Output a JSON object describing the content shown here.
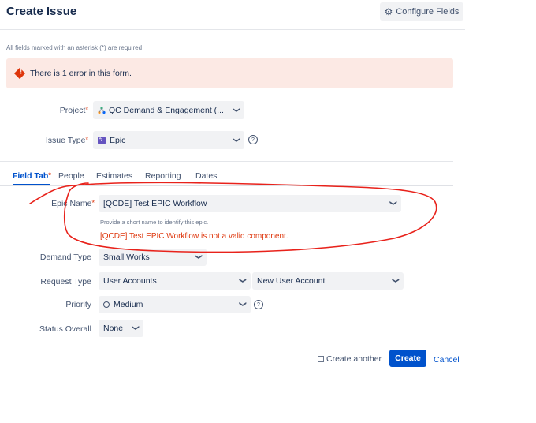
{
  "header": {
    "title": "Create Issue",
    "configure_label": "Configure Fields"
  },
  "required_note": "All fields marked with an asterisk (*) are required",
  "error_banner": {
    "text": "There is 1 error in this form."
  },
  "project": {
    "label": "Project",
    "value": "QC Demand & Engagement (..."
  },
  "issue_type": {
    "label": "Issue Type",
    "value": "Epic"
  },
  "tabs": [
    {
      "label": "Field Tab",
      "required": true
    },
    {
      "label": "People"
    },
    {
      "label": "Estimates"
    },
    {
      "label": "Reporting"
    },
    {
      "label": "Dates"
    }
  ],
  "epic_name": {
    "label": "Epic Name",
    "value": "[QCDE] Test EPIC Workflow",
    "hint": "Provide a short name to identify this epic.",
    "error": "[QCDE] Test EPIC Workflow is not a valid component."
  },
  "demand_type": {
    "label": "Demand Type",
    "value": "Small Works"
  },
  "request_type": {
    "label": "Request Type",
    "value": "User Accounts",
    "value2": "New User Account"
  },
  "priority": {
    "label": "Priority",
    "value": "Medium"
  },
  "status_overall": {
    "label": "Status Overall",
    "value": "None"
  },
  "footer": {
    "create_another_label": "Create another",
    "create_label": "Create",
    "cancel_label": "Cancel"
  },
  "colors": {
    "primary": "#0052cc",
    "error": "#de350b",
    "error_bg": "#fce9e4",
    "annotation": "#e8221b"
  }
}
